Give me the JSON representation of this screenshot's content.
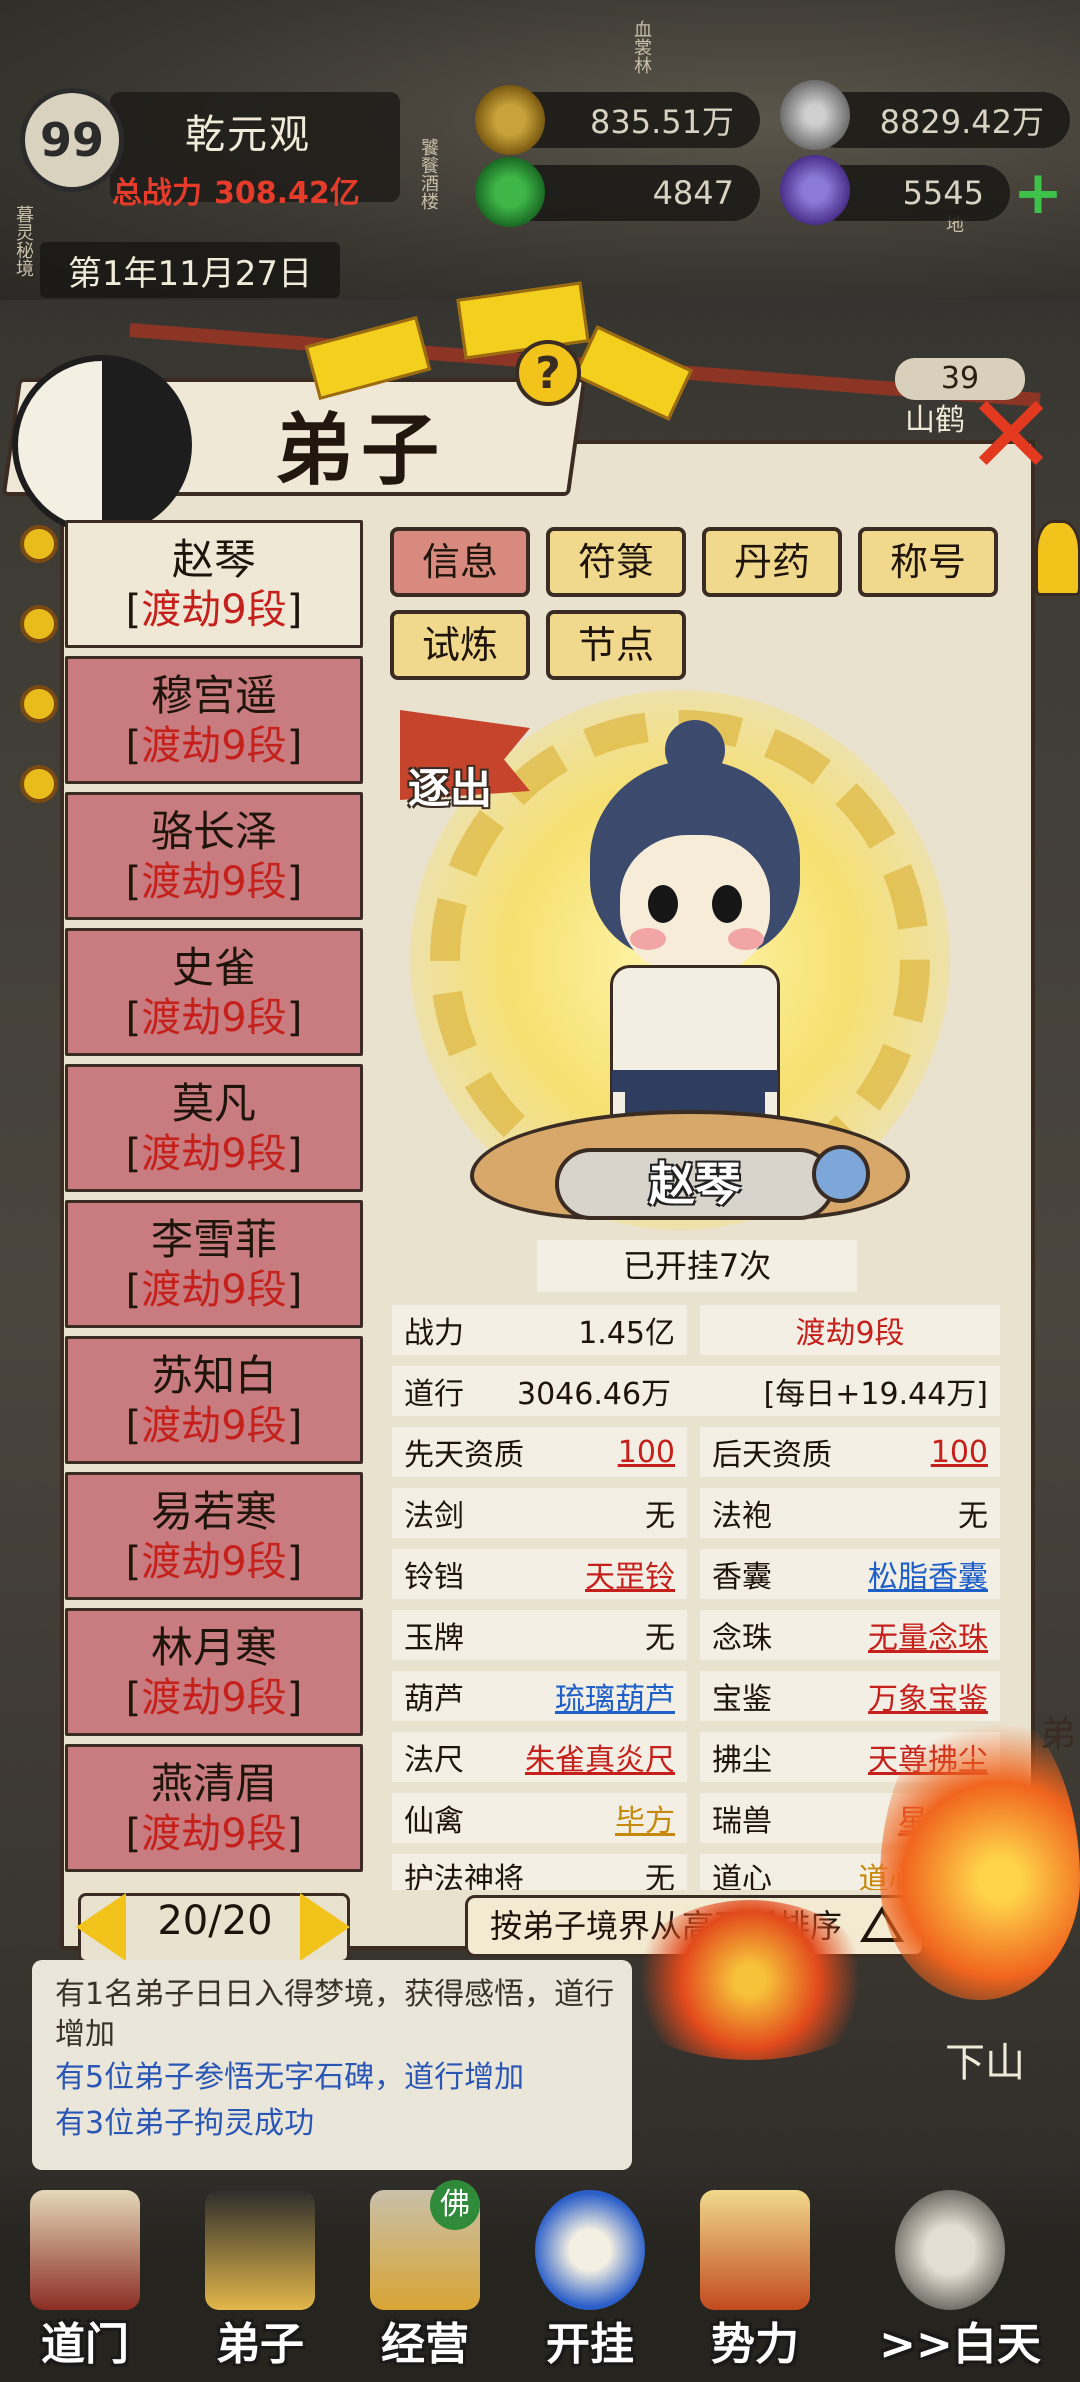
{
  "hud": {
    "sect_level": "99",
    "sect_name": "乾元观",
    "power_label": "总战力",
    "power_value": "308.42亿",
    "date": "第1年11月27日",
    "resources": [
      {
        "icon": "copper-coin-icon",
        "value": "835.51万"
      },
      {
        "icon": "incense-smoke-icon",
        "value": "8829.42万"
      },
      {
        "icon": "green-jade-icon",
        "value": "4847"
      },
      {
        "icon": "purple-scroll-icon",
        "value": "5545"
      }
    ],
    "map_labels": [
      "血裳林",
      "饕餮酒楼",
      "暮灵秘境",
      "地"
    ],
    "crane_level": "39",
    "crane_label": "山鹤"
  },
  "dialog": {
    "title": "弟子",
    "tabs": [
      "信息",
      "符箓",
      "丹药",
      "称号",
      "试炼",
      "节点"
    ],
    "active_tab": "信息"
  },
  "disciples": [
    {
      "name": "赵琴",
      "realm": "渡劫9段"
    },
    {
      "name": "穆宫遥",
      "realm": "渡劫9段"
    },
    {
      "name": "骆长泽",
      "realm": "渡劫9段"
    },
    {
      "name": "史雀",
      "realm": "渡劫9段"
    },
    {
      "name": "莫凡",
      "realm": "渡劫9段"
    },
    {
      "name": "李雪菲",
      "realm": "渡劫9段"
    },
    {
      "name": "苏知白",
      "realm": "渡劫9段"
    },
    {
      "name": "易若寒",
      "realm": "渡劫9段"
    },
    {
      "name": "林月寒",
      "realm": "渡劫9段"
    },
    {
      "name": "燕清眉",
      "realm": "渡劫9段"
    }
  ],
  "pager": {
    "text": "20/20"
  },
  "portrait": {
    "expel_label": "逐出",
    "name": "赵琴",
    "hang_count": "已开挂7次"
  },
  "stats": {
    "power_label": "战力",
    "power_value": "1.45亿",
    "realm": "渡劫9段",
    "dao_label": "道行",
    "dao_value": "3046.46万",
    "daily": "[每日+19.44万]",
    "innate_label": "先天资质",
    "innate_value": "100",
    "acquired_label": "后天资质",
    "acquired_value": "100",
    "items": [
      {
        "label": "法剑",
        "value": "无",
        "color": "#1e140b"
      },
      {
        "label": "法袍",
        "value": "无",
        "color": "#1e140b"
      },
      {
        "label": "铃铛",
        "value": "天罡铃",
        "color": "#c5201c"
      },
      {
        "label": "香囊",
        "value": "松脂香囊",
        "color": "#1f5fc8"
      },
      {
        "label": "玉牌",
        "value": "无",
        "color": "#1e140b"
      },
      {
        "label": "念珠",
        "value": "无量念珠",
        "color": "#c5201c"
      },
      {
        "label": "葫芦",
        "value": "琉璃葫芦",
        "color": "#1f5fc8"
      },
      {
        "label": "宝鉴",
        "value": "万象宝鉴",
        "color": "#c5201c"
      },
      {
        "label": "法尺",
        "value": "朱雀真炎尺",
        "color": "#c5201c"
      },
      {
        "label": "拂尘",
        "value": "天尊拂尘",
        "color": "#c5201c"
      },
      {
        "label": "仙禽",
        "value": "毕方",
        "color": "#c58a0c"
      },
      {
        "label": "瑞兽",
        "value": "星云兽",
        "color": "#c5201c"
      },
      {
        "label": "护法神将",
        "value": "无",
        "color": "#1e140b"
      },
      {
        "label": "道心",
        "value": "道心·破妄",
        "color": "#c58a0c"
      }
    ]
  },
  "sort_button": "按弟子境界从高到低排序",
  "messages": [
    {
      "text": "有1名弟子日日入得梦境，获得感悟，道行增加",
      "style": "dark"
    },
    {
      "text": "有5位弟子参悟无字石碑，道行增加",
      "style": "blue"
    },
    {
      "text": "有3位弟子拘灵成功",
      "style": "blue"
    }
  ],
  "side": {
    "downhill": "下山",
    "side_char": "弟"
  },
  "nav": [
    {
      "label": "道门",
      "icon": "gate-icon"
    },
    {
      "label": "弟子",
      "icon": "disciple-icon"
    },
    {
      "label": "经营",
      "icon": "shop-icon",
      "badge": "佛"
    },
    {
      "label": "开挂",
      "icon": "taiji-flame-icon"
    },
    {
      "label": "势力",
      "icon": "banner-icon"
    },
    {
      "label": ">>白天",
      "icon": "day-cycle-icon"
    }
  ]
}
